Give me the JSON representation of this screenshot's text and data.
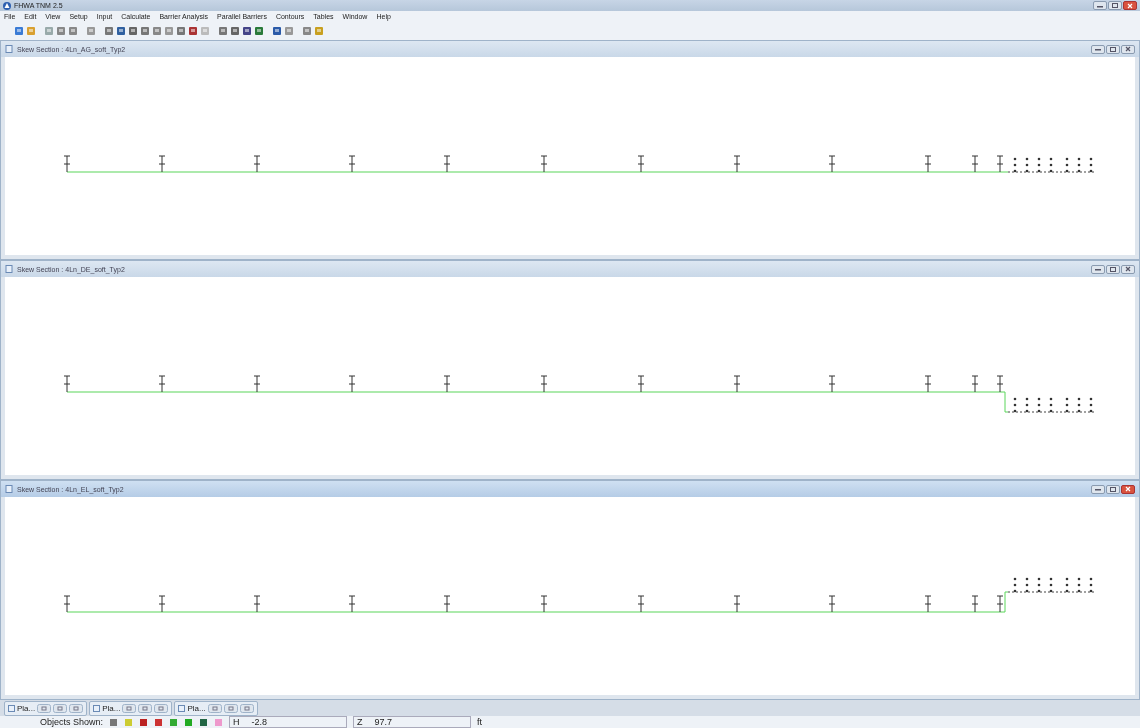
{
  "app": {
    "title": "FHWA TNM 2.5"
  },
  "menu": [
    "File",
    "Edit",
    "View",
    "Setup",
    "Input",
    "Calculate",
    "Barrier Analysis",
    "Parallel Barriers",
    "Contours",
    "Tables",
    "Window",
    "Help"
  ],
  "windows": [
    {
      "title": "Skew Section : 4Ln_AG_soft_Typ2",
      "active": false,
      "kind": "level"
    },
    {
      "title": "Skew Section : 4Ln_DE_soft_Typ2",
      "active": false,
      "kind": "step-down"
    },
    {
      "title": "Skew Section : 4Ln_EL_soft_Typ2",
      "active": true,
      "kind": "step-up"
    }
  ],
  "minimized": [
    {
      "label": "Pla..."
    },
    {
      "label": "Pla..."
    },
    {
      "label": "Pla..."
    }
  ],
  "status_bar": {
    "objects_label": "Objects Shown:",
    "h_label": "H",
    "h_value": "-2.8",
    "z_label": "Z",
    "z_value": "97.7",
    "unit": "ft"
  }
}
